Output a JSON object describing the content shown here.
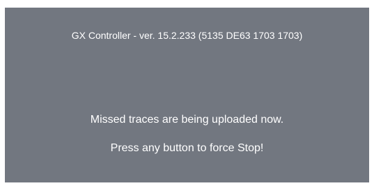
{
  "header": {
    "title": "GX Controller - ver. 15.2.233 (5135 DE63 1703 1703)"
  },
  "main": {
    "status_message": "Missed traces are being uploaded now.",
    "instruction": "Press any button to force Stop!"
  },
  "colors": {
    "screen_background": "#727780",
    "text": "#ffffff",
    "page_background": "#ffffff"
  }
}
